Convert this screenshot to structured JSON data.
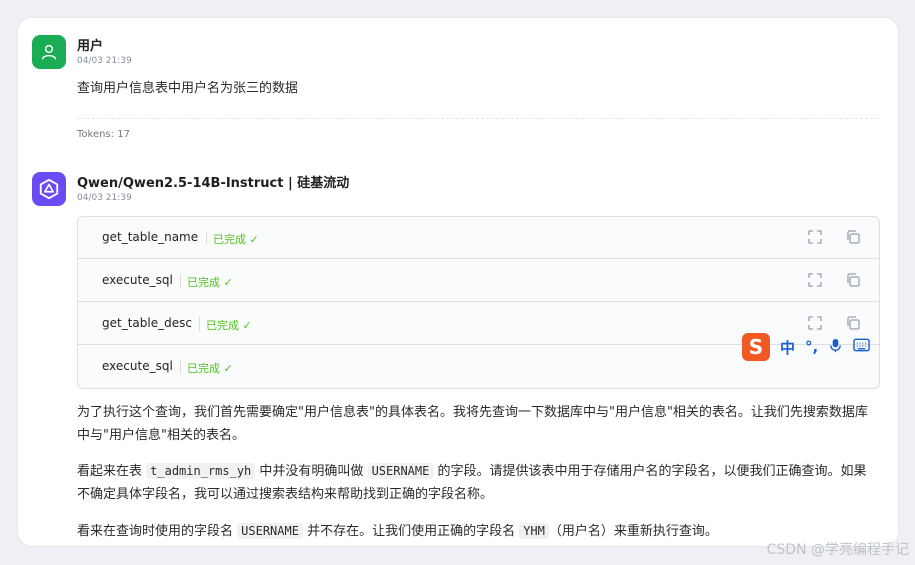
{
  "messages": {
    "user": {
      "name": "用户",
      "time": "04/03 21:39",
      "text": "查询用户信息表中用户名为张三的数据",
      "tokens": "Tokens: 17"
    },
    "assistant": {
      "name": "Qwen/Qwen2.5-14B-Instruct | 硅基流动",
      "time": "04/03 21:39",
      "tools": [
        {
          "name": "get_table_name",
          "status": "已完成 ✓"
        },
        {
          "name": "execute_sql",
          "status": "已完成 ✓"
        },
        {
          "name": "get_table_desc",
          "status": "已完成 ✓"
        },
        {
          "name": "execute_sql",
          "status": "已完成 ✓"
        }
      ],
      "para1": "为了执行这个查询，我们首先需要确定\"用户信息表\"的具体表名。我将先查询一下数据库中与\"用户信息\"相关的表名。让我们先搜索数据库中与\"用户信息\"相关的表名。",
      "para2": {
        "a": "看起来在表 ",
        "code1": "t_admin_rms_yh",
        "b": " 中并没有明确叫做 ",
        "code2": "USERNAME",
        "c": " 的字段。请提供该表中用于存储用户名的字段名，以便我们正确查询。如果不确定具体字段名，我可以通过搜索表结构来帮助找到正确的字段名称。"
      },
      "para3": {
        "a": "看来在查询时使用的字段名 ",
        "code1": "USERNAME",
        "b": " 并不存在。让我们使用正确的字段名 ",
        "code2": "YHM",
        "c": "（用户名）来重新执行查询。"
      }
    }
  },
  "ime": {
    "logo": "S",
    "lang": "中",
    "punct": "°,",
    "mic": "🎤",
    "keyboard": "⌨"
  },
  "watermark": "CSDN @学亮编程手记",
  "colors": {
    "user_avatar": "#1aad55",
    "assistant_avatar": "#6a4cf5",
    "success": "#52c41a"
  }
}
